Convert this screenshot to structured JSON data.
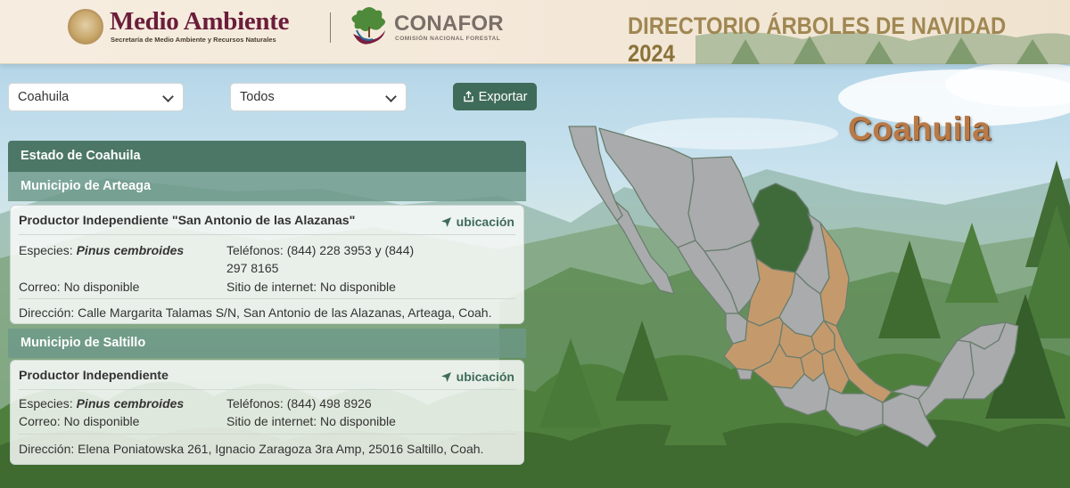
{
  "header": {
    "agency_title": "Medio Ambiente",
    "agency_subtitle": "Secretaría de Medio Ambiente y Recursos Naturales",
    "partner_name": "CONAFOR",
    "partner_subtitle": "COMISIÓN NACIONAL FORESTAL",
    "directory_title": "DIRECTORIO ÁRBOLES DE NAVIDAD",
    "directory_year": "2024"
  },
  "filters": {
    "state_value": "Coahuila",
    "municipality_value": "Todos",
    "export_label": "Exportar"
  },
  "directory": {
    "state_heading": "Estado de Coahuila",
    "municipalities": [
      {
        "heading": "Municipio de Arteaga",
        "producer": {
          "name": "Productor Independiente \"San Antonio de las Alazanas\"",
          "location_label": "ubicación",
          "species_label": "Especies:",
          "species_value": "Pinus cembroides",
          "phones_line1": "Teléfonos: (844) 228 3953 y (844)",
          "phones_line2": "297 8165",
          "email": "Correo: No disponible",
          "website": "Sitio de internet: No disponible",
          "address": "Dirección: Calle Margarita Talamas S/N, San Antonio de las Alazanas, Arteaga, Coah."
        }
      },
      {
        "heading": "Municipio de Saltillo",
        "producer": {
          "name": "Productor Independiente",
          "location_label": "ubicación",
          "species_label": "Especies:",
          "species_value": "Pinus cembroides",
          "phones_line1": "Teléfonos: (844) 498 8926",
          "email": "Correo: No disponible",
          "website": "Sitio de internet: No disponible",
          "address": "Dirección: Elena Poniatowska 261, Ignacio Zaragoza 3ra Amp, 25016 Saltillo, Coah."
        }
      }
    ]
  },
  "map": {
    "selected_region_label": "Coahuila",
    "colors": {
      "selected_state": "#3f6b3a",
      "producer_states": "#c49a6c",
      "other_states": "#a9abac",
      "borders": "#6a7d6e"
    }
  },
  "theme": {
    "primary_green": "#4c7767",
    "button_green": "#3f6b5a",
    "brand_maroon": "#6b1d3a",
    "title_gold": "#a08752"
  }
}
